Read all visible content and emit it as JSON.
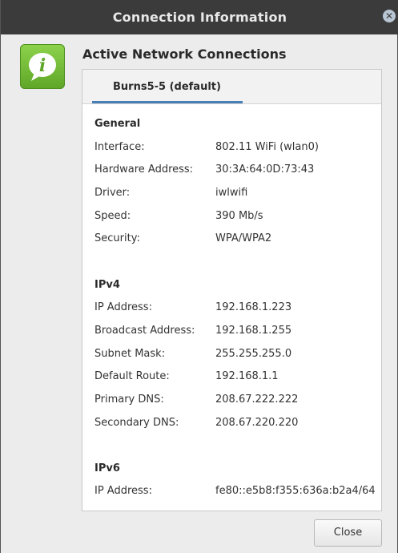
{
  "window": {
    "title": "Connection Information",
    "close_glyph": "✕"
  },
  "heading": "Active Network Connections",
  "tab": {
    "label": "Burns5-5 (default)"
  },
  "general": {
    "title": "General",
    "rows": [
      {
        "label": "Interface:",
        "value": "802.11 WiFi (wlan0)"
      },
      {
        "label": "Hardware Address:",
        "value": "30:3A:64:0D:73:43"
      },
      {
        "label": "Driver:",
        "value": "iwlwifi"
      },
      {
        "label": "Speed:",
        "value": "390 Mb/s"
      },
      {
        "label": "Security:",
        "value": "WPA/WPA2"
      }
    ]
  },
  "ipv4": {
    "title": "IPv4",
    "rows": [
      {
        "label": "IP Address:",
        "value": "192.168.1.223"
      },
      {
        "label": "Broadcast Address:",
        "value": "192.168.1.255"
      },
      {
        "label": "Subnet Mask:",
        "value": "255.255.255.0"
      },
      {
        "label": "Default Route:",
        "value": "192.168.1.1"
      },
      {
        "label": "Primary DNS:",
        "value": "208.67.222.222"
      },
      {
        "label": "Secondary DNS:",
        "value": "208.67.220.220"
      }
    ]
  },
  "ipv6": {
    "title": "IPv6",
    "rows": [
      {
        "label": "IP Address:",
        "value": "fe80::e5b8:f355:636a:b2a4/64"
      }
    ]
  },
  "buttons": {
    "close_label": "Close"
  },
  "icons": {
    "dialog_icon": "info-icon",
    "title_close": "close-icon"
  }
}
